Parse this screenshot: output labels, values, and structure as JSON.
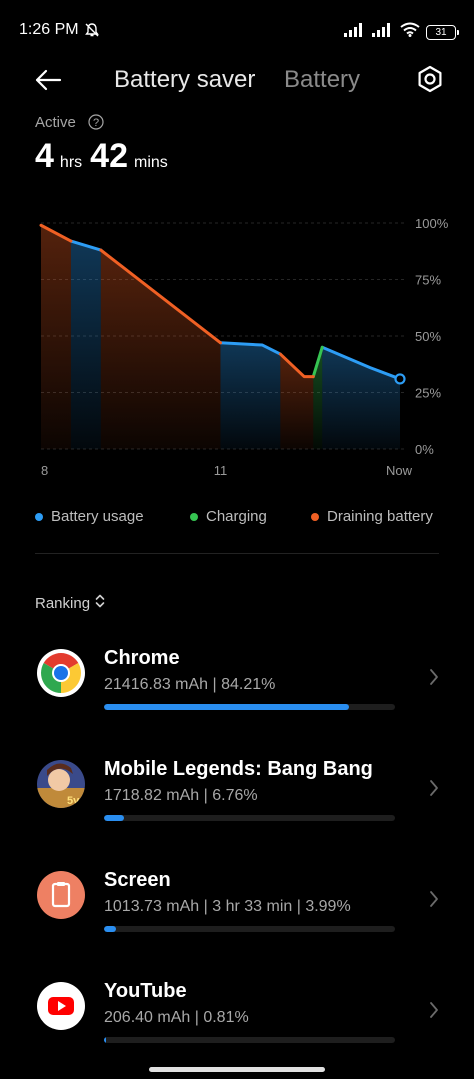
{
  "status": {
    "time": "1:26 PM",
    "battery": "31"
  },
  "header": {
    "tab_active": "Battery saver",
    "tab_inactive": "Battery"
  },
  "summary": {
    "label": "Active",
    "hours": "4",
    "hours_unit": "hrs",
    "minutes": "42",
    "minutes_unit": "mins"
  },
  "chart_data": {
    "type": "area",
    "x_ticks": [
      "8",
      "11",
      "Now"
    ],
    "y_ticks": [
      "100%",
      "75%",
      "50%",
      "25%",
      "0%"
    ],
    "ylim": [
      0,
      100
    ],
    "series": [
      {
        "name": "Battery usage",
        "color": "#2d9df5",
        "segments": [
          [
            [
              8.5,
              92
            ],
            [
              9.0,
              88
            ]
          ],
          [
            [
              11.0,
              47
            ],
            [
              11.7,
              46
            ],
            [
              12.0,
              42
            ]
          ],
          [
            [
              12.7,
              45
            ],
            [
              13.5,
              36
            ],
            [
              14.0,
              31
            ]
          ]
        ]
      },
      {
        "name": "Charging",
        "color": "#36c452",
        "segments": [
          [
            [
              12.55,
              32
            ],
            [
              12.7,
              45
            ]
          ]
        ]
      },
      {
        "name": "Draining battery",
        "color": "#f06024",
        "segments": [
          [
            [
              8.0,
              99
            ],
            [
              8.5,
              92
            ]
          ],
          [
            [
              9.0,
              88
            ],
            [
              11.0,
              47
            ]
          ],
          [
            [
              12.0,
              42
            ],
            [
              12.4,
              32
            ],
            [
              12.55,
              32
            ]
          ]
        ]
      }
    ],
    "colors": {
      "usage": "#2d9df5",
      "charging": "#36c452",
      "draining": "#f06024"
    }
  },
  "legend": [
    {
      "label": "Battery usage",
      "color": "#2d9df5"
    },
    {
      "label": "Charging",
      "color": "#36c452"
    },
    {
      "label": "Draining battery",
      "color": "#f06024"
    }
  ],
  "ranking": {
    "label": "Ranking"
  },
  "apps": [
    {
      "name": "Chrome",
      "detail": "21416.83 mAh | 84.21%",
      "percent": 84.21,
      "icon": "chrome-icon"
    },
    {
      "name": "Mobile Legends: Bang Bang",
      "detail": "1718.82 mAh | 6.76%",
      "percent": 6.76,
      "icon": "mobile-legends-icon"
    },
    {
      "name": "Screen",
      "detail": "1013.73 mAh | 3 hr 33 min  | 3.99%",
      "percent": 3.99,
      "icon": "screen-icon"
    },
    {
      "name": "YouTube",
      "detail": "206.40 mAh | 0.81%",
      "percent": 0.81,
      "icon": "youtube-icon"
    }
  ]
}
